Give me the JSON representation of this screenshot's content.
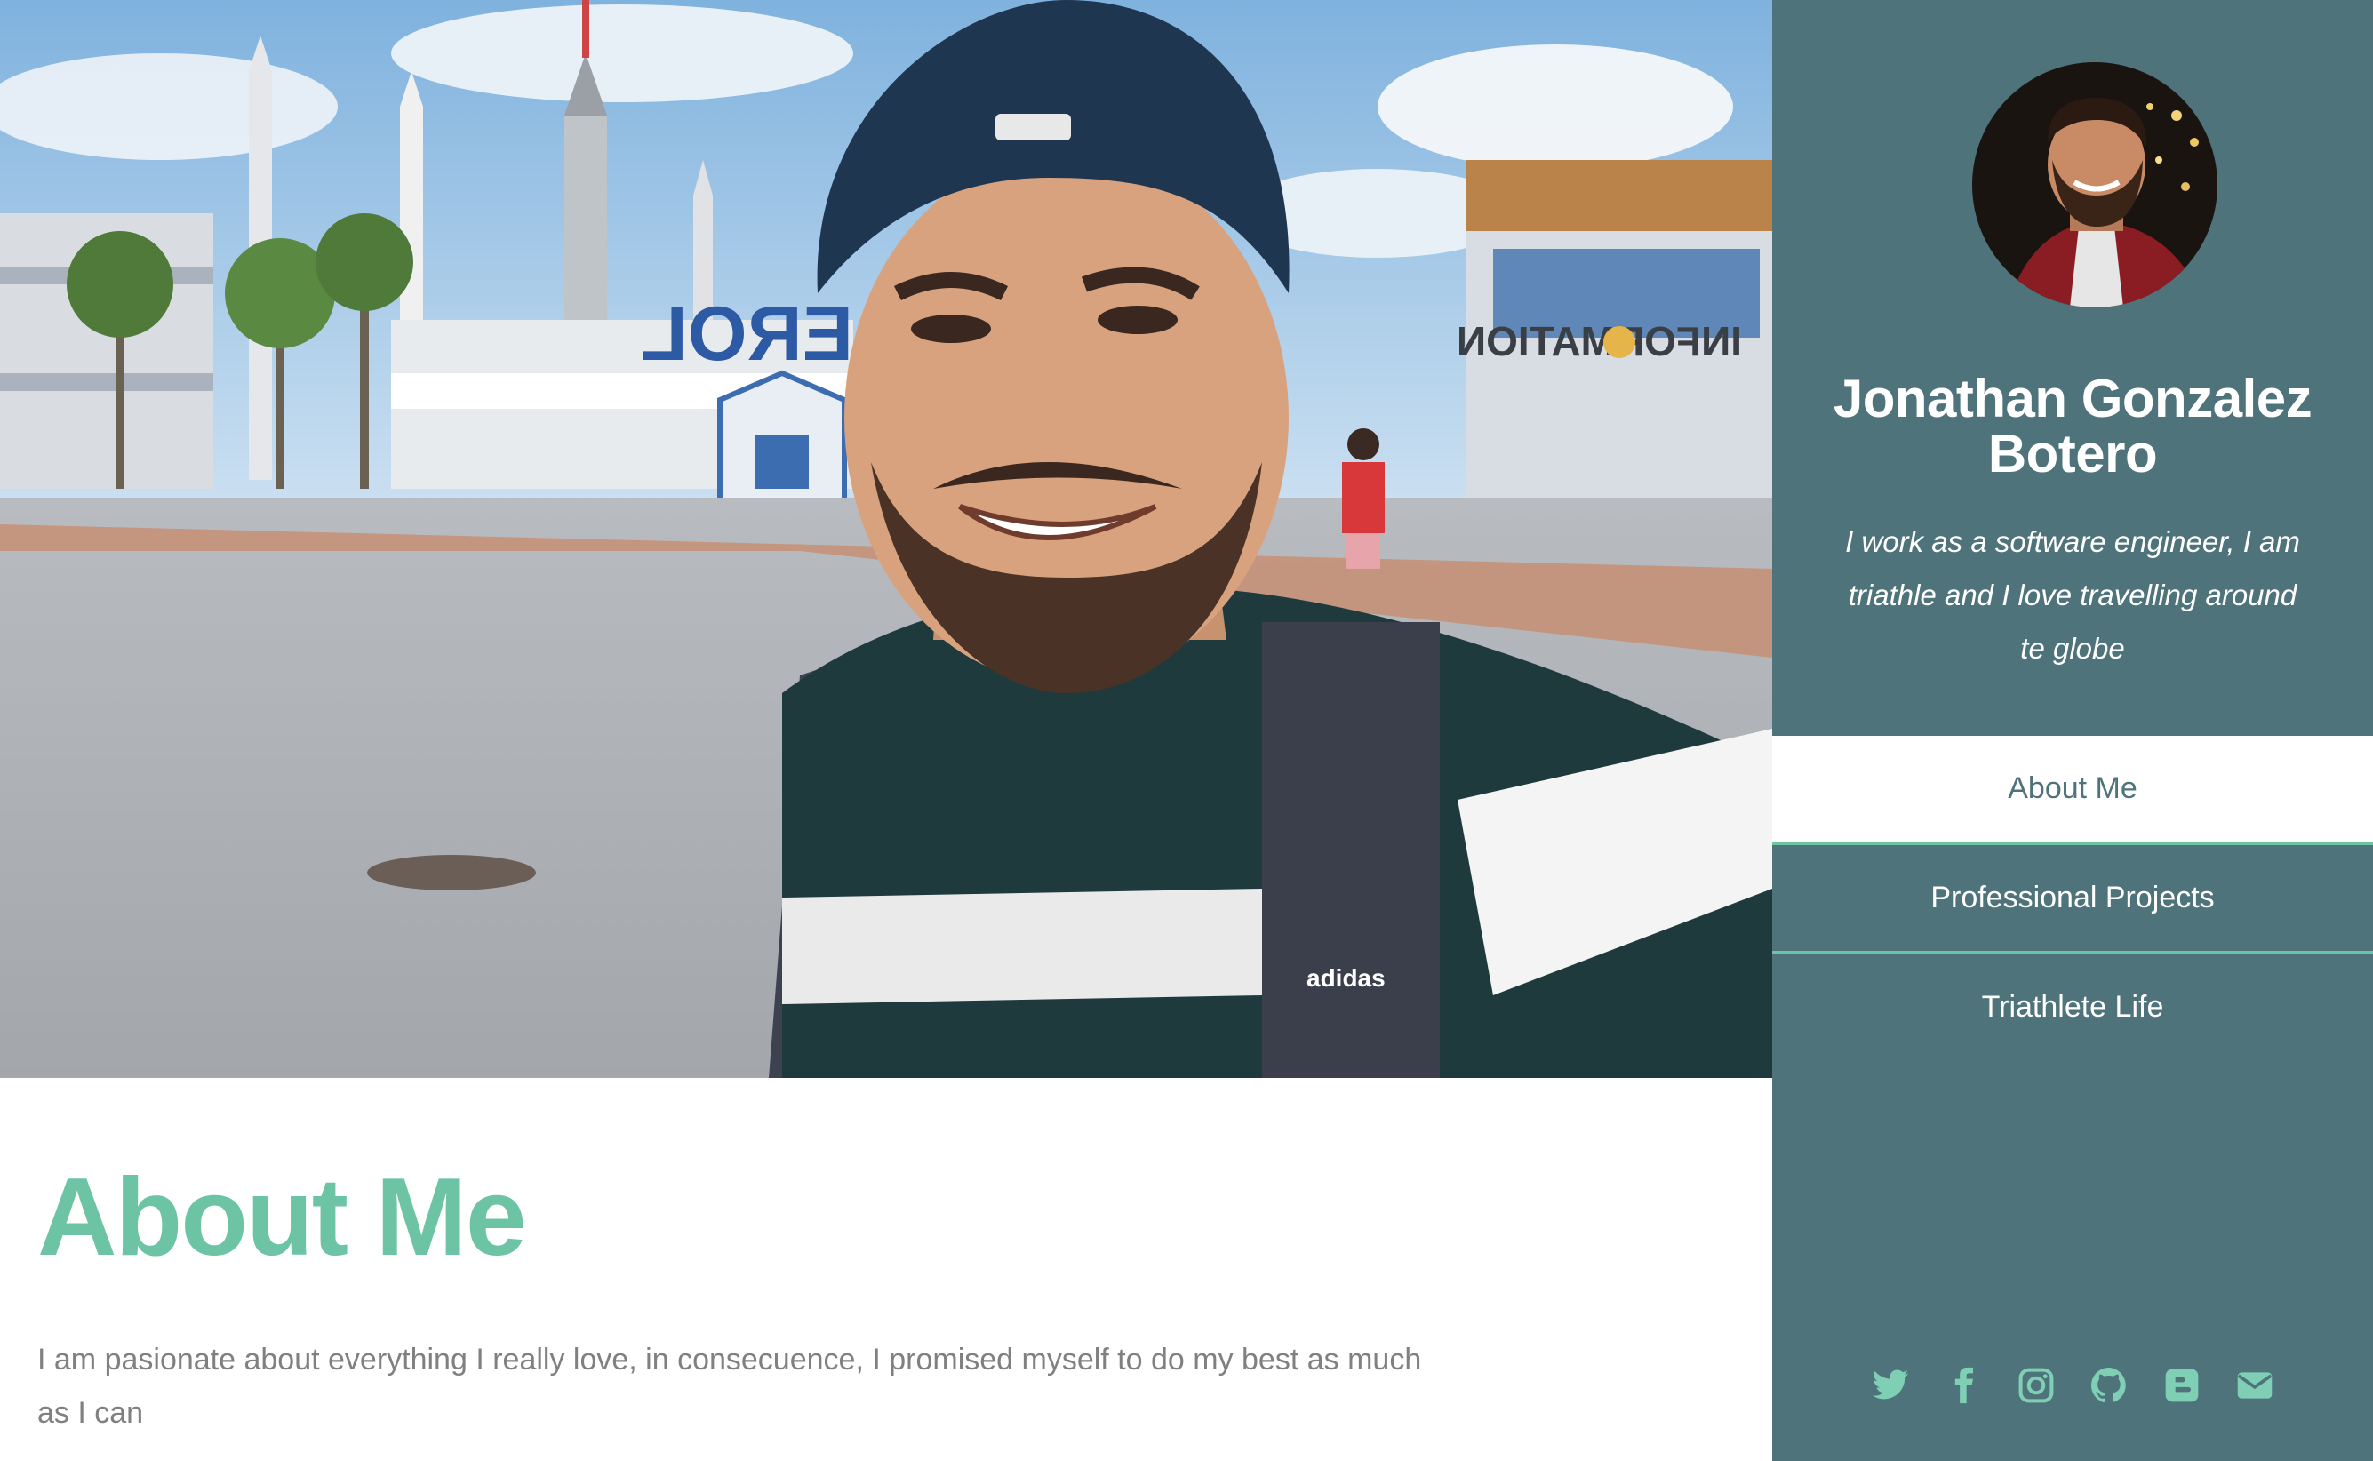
{
  "hero": {
    "image": "selfie-at-space-center",
    "sign_text": "EXPLORE"
  },
  "main": {
    "title": "About Me",
    "paragraph": "I am pasionate about everything I really love, in consecuence, I promised myself to do my best as much as I can"
  },
  "sidebar": {
    "name": "Jonathan Gonzalez Botero",
    "tagline": "I work as a software engineer, I am triathle and I love travelling around te globe",
    "nav": [
      {
        "label": "About Me",
        "active": true
      },
      {
        "label": "Professional Projects",
        "active": false
      },
      {
        "label": "Triathlete Life",
        "active": false
      }
    ],
    "social_icons": [
      "twitter-icon",
      "facebook-icon",
      "instagram-icon",
      "github-icon",
      "blogger-icon",
      "email-icon"
    ]
  },
  "colors": {
    "sidebar_bg": "#4f737a",
    "accent": "#6cc4a4",
    "body_text": "#808080"
  }
}
